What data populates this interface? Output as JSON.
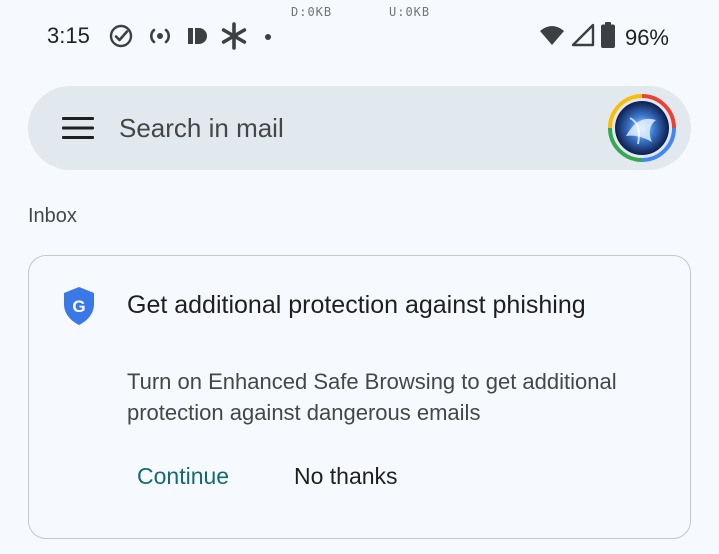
{
  "status_bar": {
    "time": "3:15",
    "net_down": "D:0KB",
    "net_up": "U:0KB",
    "battery": "96%",
    "icons": [
      "check-circle-icon",
      "broadcast-icon",
      "id-icon",
      "asterisk-icon",
      "dot-icon",
      "wifi-icon",
      "cell-signal-icon",
      "battery-icon"
    ]
  },
  "search": {
    "placeholder": "Search in mail"
  },
  "mailbox": {
    "label": "Inbox"
  },
  "promo_card": {
    "title": "Get additional protection against phishing",
    "body": "Turn on Enhanced Safe Browsing to get additional protection against dangerous emails",
    "continue_label": "Continue",
    "dismiss_label": "No thanks",
    "accent_color": "#146a74",
    "shield_color": "#3b78e7"
  }
}
